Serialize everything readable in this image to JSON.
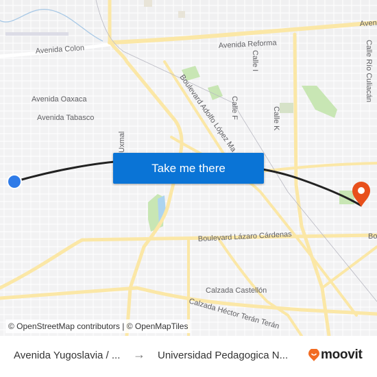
{
  "map": {
    "street_labels": [
      {
        "id": "avenida-colon",
        "text": "Avenida Colon"
      },
      {
        "id": "avenida-reforma",
        "text": "Avenida Reforma"
      },
      {
        "id": "avenida-top-right",
        "text": "Aven"
      },
      {
        "id": "avenida-oaxaca",
        "text": "Avenida Oaxaca"
      },
      {
        "id": "avenida-tabasco",
        "text": "Avenida Tabasco"
      },
      {
        "id": "calle-i",
        "text": "Calle I"
      },
      {
        "id": "calle-f",
        "text": "Calle F"
      },
      {
        "id": "calle-k",
        "text": "Calle K"
      },
      {
        "id": "calle-rio-culiacan",
        "text": "Calle Río Culiacán"
      },
      {
        "id": "boulevard-adolfo-lopez",
        "text": "Boulevard Adolfo López Ma"
      },
      {
        "id": "calle-uxmal",
        "text": "e Uxmal"
      },
      {
        "id": "boulevard-lazaro-cardenas",
        "text": "Boulevard Lázaro Cárdenas"
      },
      {
        "id": "boulevard-right-edge",
        "text": "Bo"
      },
      {
        "id": "calzada-castellon",
        "text": "Calzada Castellón"
      },
      {
        "id": "calzada-hector-teran",
        "text": "Calzada Héctor Terán Terán"
      }
    ],
    "origin_marker_color": "#2f7be8",
    "destination_marker_color": "#e8501c",
    "route_color": "#222222",
    "take_me_there_label": "Take me there",
    "attribution": "© OpenStreetMap contributors | © OpenMapTiles"
  },
  "footer": {
    "origin": "Avenida Yugoslavia / ...",
    "arrow_icon": "→",
    "destination": "Universidad Pedagogica N...",
    "brand": "moovit",
    "brand_color": "#f26b21"
  }
}
